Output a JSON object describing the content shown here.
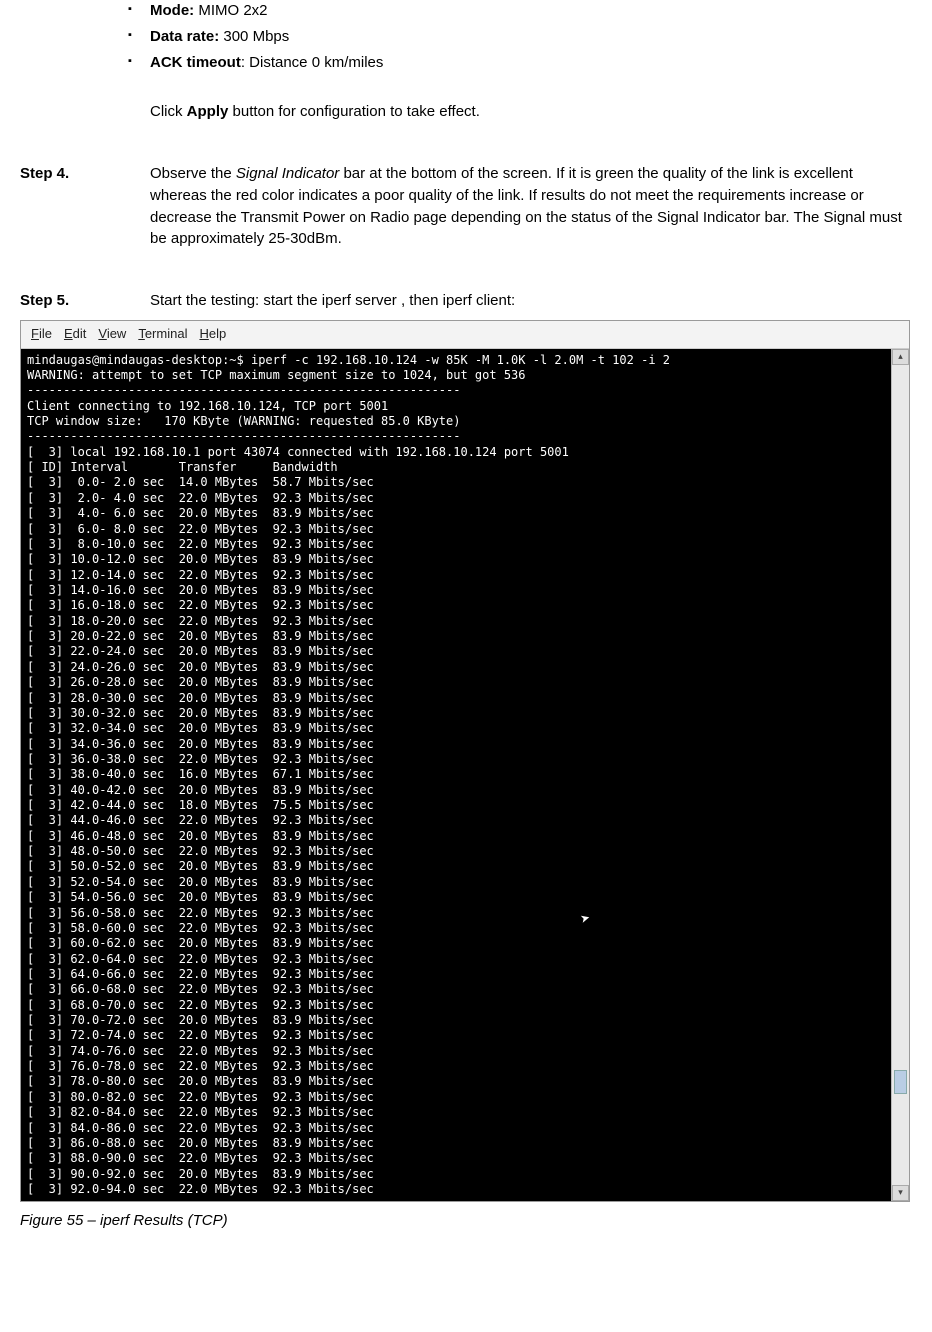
{
  "bullets": [
    {
      "label": "Mode:",
      "value": "MIMO 2x2"
    },
    {
      "label": "Data rate:",
      "value": "300 Mbps"
    },
    {
      "label": "ACK timeout",
      "suffix": ": Distance 0 km/miles"
    }
  ],
  "apply_note": {
    "pre": "Click ",
    "bold": "Apply",
    "post": " button for configuration to take effect."
  },
  "step4": {
    "label": "Step 4.",
    "a": "Observe the ",
    "italic": "Signal Indicator",
    "b": " bar at the bottom of the screen. If it is green the quality of the link is excellent whereas the red color indicates a poor quality of the link. If results do not meet the requirements increase or decrease the Transmit Power on Radio page depending on the status of the Signal Indicator  bar. The Signal must be approximately 25-30dBm."
  },
  "step5": {
    "label": "Step 5.",
    "text": "Start the testing: start the iperf server , then iperf client:"
  },
  "menubar": {
    "file": "File",
    "edit": "Edit",
    "view": "View",
    "terminal": "Terminal",
    "help": "Help"
  },
  "terminal": {
    "prompt": "mindaugas@mindaugas-desktop:~$ iperf -c 192.168.10.124 -w 85K -M 1.0K -l 2.0M -t 102 -i 2",
    "warning": "WARNING: attempt to set TCP maximum segment size to 1024, but got 536",
    "divider": "------------------------------------------------------------",
    "connecting": "Client connecting to 192.168.10.124, TCP port 5001",
    "window": "TCP window size:   170 KByte (WARNING: requested 85.0 KByte)",
    "local": "[  3] local 192.168.10.1 port 43074 connected with 192.168.10.124 port 5001",
    "header": "[ ID] Interval       Transfer     Bandwidth",
    "rows": [
      {
        "int": " 0.0- 2.0",
        "tx": "14.0",
        "bw": "58.7"
      },
      {
        "int": " 2.0- 4.0",
        "tx": "22.0",
        "bw": "92.3"
      },
      {
        "int": " 4.0- 6.0",
        "tx": "20.0",
        "bw": "83.9"
      },
      {
        "int": " 6.0- 8.0",
        "tx": "22.0",
        "bw": "92.3"
      },
      {
        "int": " 8.0-10.0",
        "tx": "22.0",
        "bw": "92.3"
      },
      {
        "int": "10.0-12.0",
        "tx": "20.0",
        "bw": "83.9"
      },
      {
        "int": "12.0-14.0",
        "tx": "22.0",
        "bw": "92.3"
      },
      {
        "int": "14.0-16.0",
        "tx": "20.0",
        "bw": "83.9"
      },
      {
        "int": "16.0-18.0",
        "tx": "22.0",
        "bw": "92.3"
      },
      {
        "int": "18.0-20.0",
        "tx": "22.0",
        "bw": "92.3"
      },
      {
        "int": "20.0-22.0",
        "tx": "20.0",
        "bw": "83.9"
      },
      {
        "int": "22.0-24.0",
        "tx": "20.0",
        "bw": "83.9"
      },
      {
        "int": "24.0-26.0",
        "tx": "20.0",
        "bw": "83.9"
      },
      {
        "int": "26.0-28.0",
        "tx": "20.0",
        "bw": "83.9"
      },
      {
        "int": "28.0-30.0",
        "tx": "20.0",
        "bw": "83.9"
      },
      {
        "int": "30.0-32.0",
        "tx": "20.0",
        "bw": "83.9"
      },
      {
        "int": "32.0-34.0",
        "tx": "20.0",
        "bw": "83.9"
      },
      {
        "int": "34.0-36.0",
        "tx": "20.0",
        "bw": "83.9"
      },
      {
        "int": "36.0-38.0",
        "tx": "22.0",
        "bw": "92.3"
      },
      {
        "int": "38.0-40.0",
        "tx": "16.0",
        "bw": "67.1"
      },
      {
        "int": "40.0-42.0",
        "tx": "20.0",
        "bw": "83.9"
      },
      {
        "int": "42.0-44.0",
        "tx": "18.0",
        "bw": "75.5"
      },
      {
        "int": "44.0-46.0",
        "tx": "22.0",
        "bw": "92.3"
      },
      {
        "int": "46.0-48.0",
        "tx": "20.0",
        "bw": "83.9"
      },
      {
        "int": "48.0-50.0",
        "tx": "22.0",
        "bw": "92.3"
      },
      {
        "int": "50.0-52.0",
        "tx": "20.0",
        "bw": "83.9"
      },
      {
        "int": "52.0-54.0",
        "tx": "20.0",
        "bw": "83.9"
      },
      {
        "int": "54.0-56.0",
        "tx": "20.0",
        "bw": "83.9"
      },
      {
        "int": "56.0-58.0",
        "tx": "22.0",
        "bw": "92.3"
      },
      {
        "int": "58.0-60.0",
        "tx": "22.0",
        "bw": "92.3"
      },
      {
        "int": "60.0-62.0",
        "tx": "20.0",
        "bw": "83.9"
      },
      {
        "int": "62.0-64.0",
        "tx": "22.0",
        "bw": "92.3"
      },
      {
        "int": "64.0-66.0",
        "tx": "22.0",
        "bw": "92.3"
      },
      {
        "int": "66.0-68.0",
        "tx": "22.0",
        "bw": "92.3"
      },
      {
        "int": "68.0-70.0",
        "tx": "22.0",
        "bw": "92.3"
      },
      {
        "int": "70.0-72.0",
        "tx": "20.0",
        "bw": "83.9"
      },
      {
        "int": "72.0-74.0",
        "tx": "22.0",
        "bw": "92.3"
      },
      {
        "int": "74.0-76.0",
        "tx": "22.0",
        "bw": "92.3"
      },
      {
        "int": "76.0-78.0",
        "tx": "22.0",
        "bw": "92.3"
      },
      {
        "int": "78.0-80.0",
        "tx": "20.0",
        "bw": "83.9"
      },
      {
        "int": "80.0-82.0",
        "tx": "22.0",
        "bw": "92.3"
      },
      {
        "int": "82.0-84.0",
        "tx": "22.0",
        "bw": "92.3"
      },
      {
        "int": "84.0-86.0",
        "tx": "22.0",
        "bw": "92.3"
      },
      {
        "int": "86.0-88.0",
        "tx": "20.0",
        "bw": "83.9"
      },
      {
        "int": "88.0-90.0",
        "tx": "22.0",
        "bw": "92.3"
      },
      {
        "int": "90.0-92.0",
        "tx": "20.0",
        "bw": "83.9"
      },
      {
        "int": "92.0-94.0",
        "tx": "22.0",
        "bw": "92.3"
      }
    ]
  },
  "caption": "Figure 55 – iperf Results (TCP)"
}
